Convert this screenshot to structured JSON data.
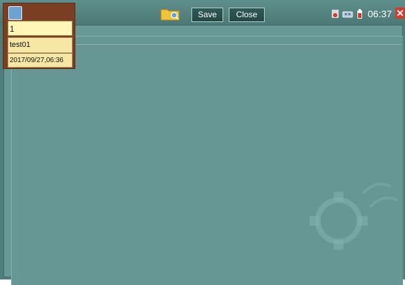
{
  "toolbar": {
    "save_label": "Save",
    "close_label": "Close",
    "folder_icon": "folder-search-icon"
  },
  "status": {
    "time": "06:37",
    "icons": [
      "record-icon",
      "network-icon",
      "battery-icon"
    ],
    "close_icon": "close-x-icon",
    "close_color": "#d73a2a"
  },
  "popup": {
    "field_value": "1",
    "name": "test01",
    "datetime": "2017/09/27,06:36"
  },
  "colors": {
    "background": "#4f7e7b",
    "panel": "#669795",
    "popup_field": "#fff6b8"
  }
}
